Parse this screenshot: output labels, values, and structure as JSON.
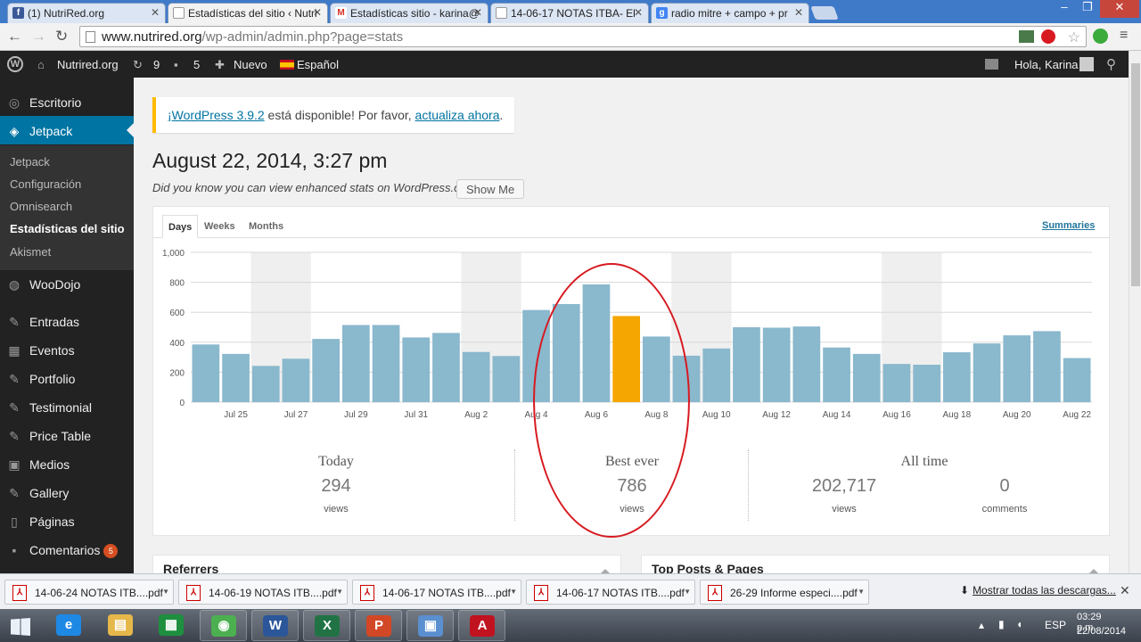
{
  "browser": {
    "tabs": [
      {
        "title": "(1) NutriRed.org",
        "icon": "facebook-icon",
        "color": "#3b5998",
        "active": false
      },
      {
        "title": "Estadísticas del sitio ‹ Nutri",
        "icon": "document-icon",
        "color": "#888888",
        "active": true
      },
      {
        "title": "Estadísticas sitio - karina@",
        "icon": "gmail-icon",
        "color": "#d93025",
        "active": false
      },
      {
        "title": "14-06-17 NOTAS ITBA- El",
        "icon": "document-icon",
        "color": "#888888",
        "active": false
      },
      {
        "title": "radio mitre + campo + pr",
        "icon": "google-icon",
        "color": "#4285f4",
        "active": false
      }
    ],
    "url_domain": "www.nutrired.org",
    "url_path": "/wp-admin/admin.php?page=stats"
  },
  "adminbar": {
    "site": "Nutrired.org",
    "updates": "9",
    "comments": "5",
    "new": "Nuevo",
    "lang": "Español",
    "greeting": "Hola, Karina"
  },
  "sidebar": {
    "items": [
      {
        "label": "Escritorio",
        "icon": "dashboard-icon"
      },
      {
        "label": "Jetpack",
        "icon": "jetpack-icon"
      },
      {
        "label": "WooDojo",
        "icon": "woodojo-icon"
      },
      {
        "label": "Entradas",
        "icon": "pin-icon"
      },
      {
        "label": "Eventos",
        "icon": "calendar-icon"
      },
      {
        "label": "Portfolio",
        "icon": "pin-icon"
      },
      {
        "label": "Testimonial",
        "icon": "pin-icon"
      },
      {
        "label": "Price Table",
        "icon": "pin-icon"
      },
      {
        "label": "Medios",
        "icon": "media-icon"
      },
      {
        "label": "Gallery",
        "icon": "pin-icon"
      },
      {
        "label": "Páginas",
        "icon": "page-icon"
      },
      {
        "label": "Comentarios",
        "icon": "comment-icon",
        "badge": "5"
      }
    ],
    "submenu": [
      "Jetpack",
      "Configuración",
      "Omnisearch",
      "Estadísticas del sitio",
      "Akismet"
    ]
  },
  "notice": {
    "link1": "¡WordPress 3.9.2",
    "text": " está disponible! Por favor, ",
    "link2": "actualiza ahora",
    "end": "."
  },
  "page": {
    "title": "August 22, 2014, 3:27 pm",
    "enhanced": "Did you know you can view enhanced stats on WordPress.com?",
    "show_me": "Show Me"
  },
  "stats": {
    "period_tabs": [
      "Days",
      "Weeks",
      "Months"
    ],
    "summaries": "Summaries",
    "today_caption": "Today",
    "today_value": "294",
    "today_unit": "views",
    "best_caption": "Best ever",
    "best_value": "786",
    "best_unit": "views",
    "alltime_caption": "All time",
    "alltime_views": "202,717",
    "alltime_views_unit": "views",
    "alltime_comments": "0",
    "alltime_comments_unit": "comments"
  },
  "chart_data": {
    "type": "bar",
    "categories": [
      "Jul 24",
      "Jul 25",
      "Jul 26",
      "Jul 27",
      "Jul 28",
      "Jul 29",
      "Jul 30",
      "Jul 31",
      "Aug 1",
      "Aug 2",
      "Aug 3",
      "Aug 4",
      "Aug 5",
      "Aug 6",
      "Aug 7",
      "Aug 8",
      "Aug 9",
      "Aug 10",
      "Aug 11",
      "Aug 12",
      "Aug 13",
      "Aug 14",
      "Aug 15",
      "Aug 16",
      "Aug 17",
      "Aug 18",
      "Aug 19",
      "Aug 20",
      "Aug 21",
      "Aug 22"
    ],
    "values": [
      385,
      322,
      242,
      290,
      422,
      515,
      515,
      432,
      462,
      335,
      308,
      615,
      655,
      786,
      575,
      438,
      310,
      358,
      500,
      497,
      505,
      365,
      322,
      255,
      250,
      333,
      392,
      446,
      474,
      294
    ],
    "highlight_index": 14,
    "tick_labels": [
      "Jul 25",
      "Jul 27",
      "Jul 29",
      "Jul 31",
      "Aug 2",
      "Aug 4",
      "Aug 6",
      "Aug 8",
      "Aug 10",
      "Aug 12",
      "Aug 14",
      "Aug 16",
      "Aug 18",
      "Aug 20",
      "Aug 22"
    ],
    "yticks": [
      "0",
      "200",
      "400",
      "600",
      "800",
      "1,000"
    ],
    "ylim": [
      0,
      1000
    ],
    "bar_color": "#8ab8cd",
    "highlight_color": "#f6a600",
    "weekend_band_color": "#efefef",
    "grid": true
  },
  "panels": {
    "referrers": "Referrers",
    "top_posts": "Top Posts & Pages"
  },
  "downloads": {
    "files": [
      "14-06-24 NOTAS ITB....pdf",
      "14-06-19 NOTAS ITB....pdf",
      "14-06-17 NOTAS ITB....pdf",
      "14-06-17 NOTAS ITB....pdf",
      "26-29 Informe especi....pdf"
    ],
    "show_all": "Mostrar todas las descargas..."
  },
  "taskbar": {
    "apps": [
      {
        "name": "ie-icon",
        "color": "#1e88e5",
        "glyph": "e"
      },
      {
        "name": "explorer-icon",
        "color": "#e6b84a",
        "glyph": "▤"
      },
      {
        "name": "excel-green-icon",
        "color": "#1e8f3e",
        "glyph": "▦"
      },
      {
        "name": "chrome-icon",
        "color": "#4caf50",
        "glyph": "◉"
      },
      {
        "name": "word-icon",
        "color": "#2b579a",
        "glyph": "W"
      },
      {
        "name": "excel-icon",
        "color": "#217346",
        "glyph": "X"
      },
      {
        "name": "powerpoint-icon",
        "color": "#d24726",
        "glyph": "P"
      },
      {
        "name": "remote-icon",
        "color": "#5a8fd0",
        "glyph": "▣"
      },
      {
        "name": "acrobat-icon",
        "color": "#c1121f",
        "glyph": "A"
      }
    ],
    "lang": "ESP",
    "time": "03:29 p.m.",
    "date": "22/08/2014"
  }
}
